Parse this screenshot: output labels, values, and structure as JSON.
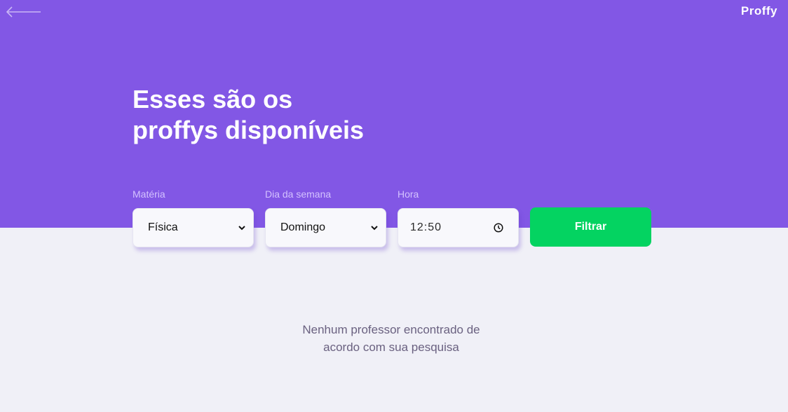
{
  "header": {
    "back_icon": "arrow-left-icon",
    "logo": "Proffy"
  },
  "hero": {
    "title_line1": "Esses são os",
    "title_line2": "proffys disponíveis"
  },
  "filters": {
    "materia": {
      "label": "Matéria",
      "value": "Física",
      "icon": "chevron-down-icon"
    },
    "dia": {
      "label": "Dia da semana",
      "value": "Domingo",
      "icon": "chevron-down-icon"
    },
    "hora": {
      "label": "Hora",
      "value": "12:50",
      "icon": "clock-icon"
    },
    "submit_label": "Filtrar"
  },
  "results": {
    "empty_line1": "Nenhum professor encontrado de",
    "empty_line2": "acordo com sua pesquisa"
  },
  "colors": {
    "primary": "#8257E5",
    "background": "#F0F0F7",
    "button": "#04D361",
    "label": "#D4C2FF",
    "text_muted": "#6A6180"
  }
}
